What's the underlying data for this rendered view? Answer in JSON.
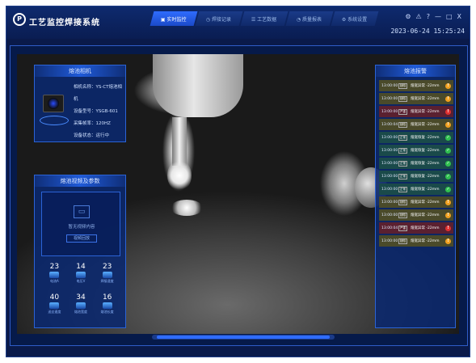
{
  "app": {
    "title": "工艺监控焊接系统",
    "logo_text": "P"
  },
  "tabs": [
    {
      "label": "实时监控",
      "icon": "monitor-icon",
      "active": true
    },
    {
      "label": "焊接记录",
      "icon": "record-icon",
      "active": false
    },
    {
      "label": "工艺数据",
      "icon": "data-icon",
      "active": false
    },
    {
      "label": "质量报表",
      "icon": "report-icon",
      "active": false
    },
    {
      "label": "系统设置",
      "icon": "settings-icon",
      "active": false
    }
  ],
  "window_controls": [
    "⚙",
    "⚠",
    "?",
    "—",
    "□",
    "X"
  ],
  "datetime": "2023-06-24 15:25:24",
  "camera_panel": {
    "title": "熔池相机",
    "name_label": "相机名称：YS-CT熔池相机",
    "model_label": "设备型号：YSGB-601",
    "fps_label": "采集帧率：120HZ",
    "status_label": "设备状态：运行中"
  },
  "video_panel": {
    "title": "熔池视频及参数",
    "empty_text": "暂无视频内容",
    "button_label": "视频回放",
    "stats": [
      {
        "value": "23",
        "label": "电流A"
      },
      {
        "value": "14",
        "label": "电压V"
      },
      {
        "value": "23",
        "label": "焊接速度"
      },
      {
        "value": "40",
        "label": "送丝速度"
      },
      {
        "value": "34",
        "label": "熔池宽度"
      },
      {
        "value": "16",
        "label": "熔池长度"
      }
    ]
  },
  "alarm_panel": {
    "title": "熔池报警",
    "items": [
      {
        "time": "13:00:00",
        "tag": "缺陷",
        "msg": "熔宽异常 -22mm",
        "badge": "!",
        "row_color": "#4a4a2a",
        "badge_color": "#f0a020"
      },
      {
        "time": "13:00:00",
        "tag": "缺陷",
        "msg": "熔宽异常 -22mm",
        "badge": "!",
        "row_color": "#4a4a2a",
        "badge_color": "#f0a020"
      },
      {
        "time": "13:00:00",
        "tag": "严重",
        "msg": "熔宽异常 -22mm",
        "badge": "!",
        "row_color": "#5a2030",
        "badge_color": "#e03030"
      },
      {
        "time": "13:00:04",
        "tag": "缺陷",
        "msg": "熔宽异常 -22mm",
        "badge": "!",
        "row_color": "#4a4a2a",
        "badge_color": "#f0a020"
      },
      {
        "time": "13:00:00",
        "tag": "正常",
        "msg": "熔宽恢复 -22mm",
        "badge": "✓",
        "row_color": "#1a4a4a",
        "badge_color": "#30c050"
      },
      {
        "time": "13:00:00",
        "tag": "正常",
        "msg": "熔宽恢复 -22mm",
        "badge": "✓",
        "row_color": "#1a4a4a",
        "badge_color": "#30c050"
      },
      {
        "time": "13:00:00",
        "tag": "正常",
        "msg": "熔宽恢复 -22mm",
        "badge": "✓",
        "row_color": "#1a4a4a",
        "badge_color": "#30c050"
      },
      {
        "time": "13:00:00",
        "tag": "正常",
        "msg": "熔宽恢复 -22mm",
        "badge": "✓",
        "row_color": "#1a4a4a",
        "badge_color": "#30c050"
      },
      {
        "time": "13:00:00",
        "tag": "正常",
        "msg": "熔宽恢复 -22mm",
        "badge": "✓",
        "row_color": "#1a4a4a",
        "badge_color": "#30c050"
      },
      {
        "time": "13:00:00",
        "tag": "缺陷",
        "msg": "熔宽异常 -22mm",
        "badge": "!",
        "row_color": "#4a4a2a",
        "badge_color": "#f0a020"
      },
      {
        "time": "13:00:00",
        "tag": "缺陷",
        "msg": "熔宽异常 -22mm",
        "badge": "!",
        "row_color": "#4a4a2a",
        "badge_color": "#f0a020"
      },
      {
        "time": "13:00:04",
        "tag": "严重",
        "msg": "熔宽异常 -22mm",
        "badge": "!",
        "row_color": "#5a2030",
        "badge_color": "#e03030"
      },
      {
        "time": "13:00:00",
        "tag": "缺陷",
        "msg": "熔宽异常 -22mm",
        "badge": "!",
        "row_color": "#4a4a2a",
        "badge_color": "#f0a020"
      }
    ]
  }
}
